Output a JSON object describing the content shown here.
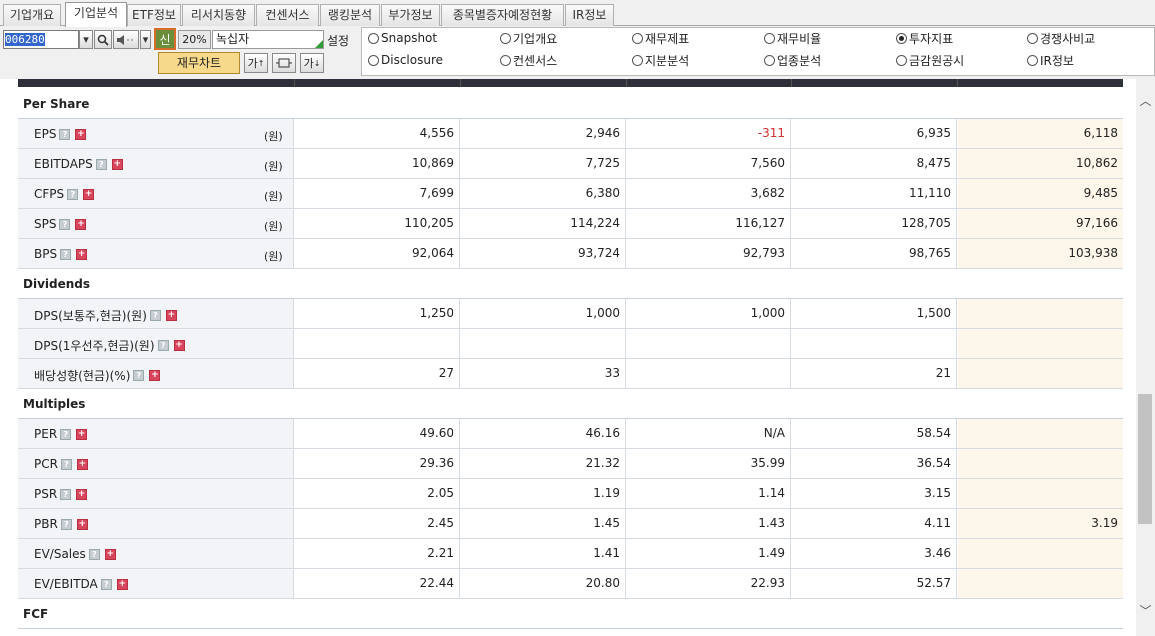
{
  "tabs": [
    "기업개요",
    "기업분석",
    "ETF정보",
    "리서치동향",
    "컨센서스",
    "랭킹분석",
    "부가정보",
    "종목별증자예정현황",
    "IR정보"
  ],
  "active_tab": 1,
  "toolbar": {
    "stock_code": "006280",
    "new_label": "신",
    "percent": "20%",
    "stock_name": "녹십자",
    "settings_label": "설정",
    "chart_button": "재무차트",
    "font_up": "가",
    "font_down": "가"
  },
  "radios": [
    {
      "label": "Snapshot",
      "checked": false
    },
    {
      "label": "기업개요",
      "checked": false
    },
    {
      "label": "재무제표",
      "checked": false
    },
    {
      "label": "재무비율",
      "checked": false
    },
    {
      "label": "투자지표",
      "checked": true
    },
    {
      "label": "경쟁사비교",
      "checked": false
    },
    {
      "label": "Disclosure",
      "checked": false
    },
    {
      "label": "컨센서스",
      "checked": false
    },
    {
      "label": "지분분석",
      "checked": false
    },
    {
      "label": "업종분석",
      "checked": false
    },
    {
      "label": "금감원공시",
      "checked": false
    },
    {
      "label": "IR정보",
      "checked": false
    }
  ],
  "table": [
    {
      "type": "section",
      "title": "Per Share"
    },
    {
      "type": "row",
      "name": "EPS",
      "unit": "(원)",
      "values": [
        "4,556",
        "2,946",
        "-311",
        "6,935",
        "6,118"
      ]
    },
    {
      "type": "row",
      "name": "EBITDAPS",
      "unit": "(원)",
      "values": [
        "10,869",
        "7,725",
        "7,560",
        "8,475",
        "10,862"
      ]
    },
    {
      "type": "row",
      "name": "CFPS",
      "unit": "(원)",
      "values": [
        "7,699",
        "6,380",
        "3,682",
        "11,110",
        "9,485"
      ]
    },
    {
      "type": "row",
      "name": "SPS",
      "unit": "(원)",
      "values": [
        "110,205",
        "114,224",
        "116,127",
        "128,705",
        "97,166"
      ]
    },
    {
      "type": "row",
      "name": "BPS",
      "unit": "(원)",
      "values": [
        "92,064",
        "93,724",
        "92,793",
        "98,765",
        "103,938"
      ]
    },
    {
      "type": "section",
      "title": "Dividends"
    },
    {
      "type": "row",
      "name": "DPS(보통주,현금)(원)",
      "unit": "",
      "values": [
        "1,250",
        "1,000",
        "1,000",
        "1,500",
        ""
      ]
    },
    {
      "type": "row",
      "name": "DPS(1우선주,현금)(원)",
      "unit": "",
      "values": [
        "",
        "",
        "",
        "",
        ""
      ]
    },
    {
      "type": "row",
      "name": "배당성향(현금)(%)",
      "unit": "",
      "values": [
        "27",
        "33",
        "",
        "21",
        ""
      ]
    },
    {
      "type": "section",
      "title": "Multiples"
    },
    {
      "type": "row",
      "name": "PER",
      "unit": "",
      "values": [
        "49.60",
        "46.16",
        "N/A",
        "58.54",
        ""
      ]
    },
    {
      "type": "row",
      "name": "PCR",
      "unit": "",
      "values": [
        "29.36",
        "21.32",
        "35.99",
        "36.54",
        ""
      ]
    },
    {
      "type": "row",
      "name": "PSR",
      "unit": "",
      "values": [
        "2.05",
        "1.19",
        "1.14",
        "3.15",
        ""
      ]
    },
    {
      "type": "row",
      "name": "PBR",
      "unit": "",
      "values": [
        "2.45",
        "1.45",
        "1.43",
        "4.11",
        "3.19"
      ]
    },
    {
      "type": "row",
      "name": "EV/Sales",
      "unit": "",
      "values": [
        "2.21",
        "1.41",
        "1.49",
        "3.46",
        ""
      ]
    },
    {
      "type": "row",
      "name": "EV/EBITDA",
      "unit": "",
      "values": [
        "22.44",
        "20.80",
        "22.93",
        "52.57",
        ""
      ]
    },
    {
      "type": "section",
      "title": "FCF"
    }
  ],
  "colors": {
    "negative": "#d03030",
    "estimate_bg": "#fdf6ea",
    "label_bg": "#f2f4f8",
    "header_bar": "#2d3038"
  },
  "icons": {
    "help": "question-icon",
    "expand": "plus-icon"
  }
}
